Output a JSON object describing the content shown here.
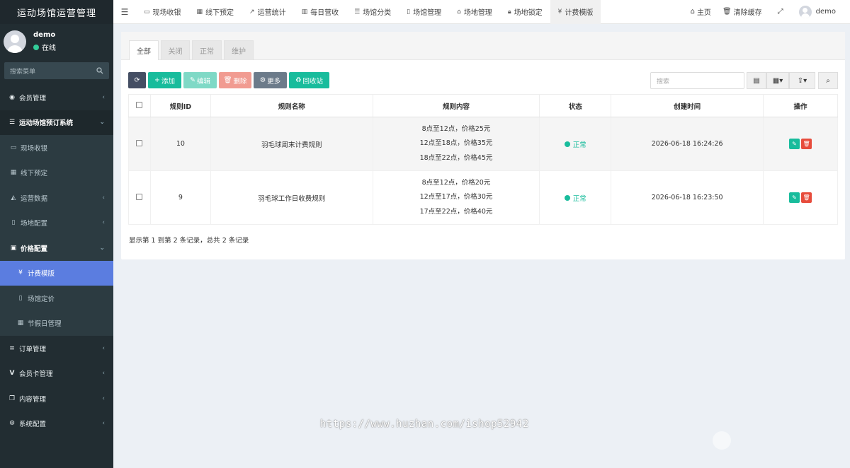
{
  "app": {
    "title": "运动场馆运营管理"
  },
  "user": {
    "name": "demo",
    "status": "在线"
  },
  "sidebar": {
    "search_placeholder": "搜索菜单",
    "items": [
      {
        "label": "会员管理",
        "icon": "user-circle-icon"
      },
      {
        "label": "运动场馆预订系统",
        "icon": "list-icon"
      },
      {
        "label": "现场收银",
        "icon": "desktop-icon"
      },
      {
        "label": "线下预定",
        "icon": "calendar-icon"
      },
      {
        "label": "运营数据",
        "icon": "area-chart-icon"
      },
      {
        "label": "场地配置",
        "icon": "file-icon"
      },
      {
        "label": "价格配置",
        "icon": "money-icon"
      },
      {
        "label": "计费模版",
        "icon": "yen-icon"
      },
      {
        "label": "场馆定价",
        "icon": "file-icon"
      },
      {
        "label": "节假日管理",
        "icon": "calendar-icon"
      },
      {
        "label": "订单管理",
        "icon": "bars-icon"
      },
      {
        "label": "会员卡管理",
        "icon": "vimeo-icon"
      },
      {
        "label": "内容管理",
        "icon": "copy-icon"
      },
      {
        "label": "系统配置",
        "icon": "cogs-icon"
      }
    ]
  },
  "topnav": {
    "tabs": [
      {
        "label": "现场收银",
        "icon": "desktop-icon"
      },
      {
        "label": "线下预定",
        "icon": "calendar-icon"
      },
      {
        "label": "运营统计",
        "icon": "line-chart-icon"
      },
      {
        "label": "每日营收",
        "icon": "bar-chart-icon"
      },
      {
        "label": "场馆分类",
        "icon": "list-icon"
      },
      {
        "label": "场馆管理",
        "icon": "file-icon"
      },
      {
        "label": "场地管理",
        "icon": "inbox-icon"
      },
      {
        "label": "场地锁定",
        "icon": "lock-icon"
      },
      {
        "label": "计费模版",
        "icon": "yen-icon"
      }
    ],
    "home": "主页",
    "clear_cache": "清除缓存",
    "username": "demo"
  },
  "filter_tabs": [
    "全部",
    "关闭",
    "正常",
    "维护"
  ],
  "toolbar": {
    "add": "添加",
    "edit": "编辑",
    "delete": "删除",
    "more": "更多",
    "recycle": "回收站",
    "search_placeholder": "搜索"
  },
  "table": {
    "headers": [
      "规则ID",
      "规则名称",
      "规则内容",
      "状态",
      "创建时间",
      "操作"
    ],
    "rows": [
      {
        "id": "10",
        "name": "羽毛球周末计费规则",
        "content": [
          "8点至12点，价格25元",
          "12点至18点，价格35元",
          "18点至22点，价格45元"
        ],
        "status": "正常",
        "created": "2026-06-18 16:24:26"
      },
      {
        "id": "9",
        "name": "羽毛球工作日收费规则",
        "content": [
          "8点至12点，价格20元",
          "12点至17点，价格30元",
          "17点至22点，价格40元"
        ],
        "status": "正常",
        "created": "2026-06-18 16:23:50"
      }
    ]
  },
  "pagination_info": "显示第 1 到第 2 条记录，总共 2 条记录",
  "watermark": "https://www.huzhan.com/ishop52942",
  "colors": {
    "accent": "#18bc9c",
    "sidebar": "#222d32",
    "active_menu": "#5b7de0",
    "danger": "#e74c3c"
  }
}
